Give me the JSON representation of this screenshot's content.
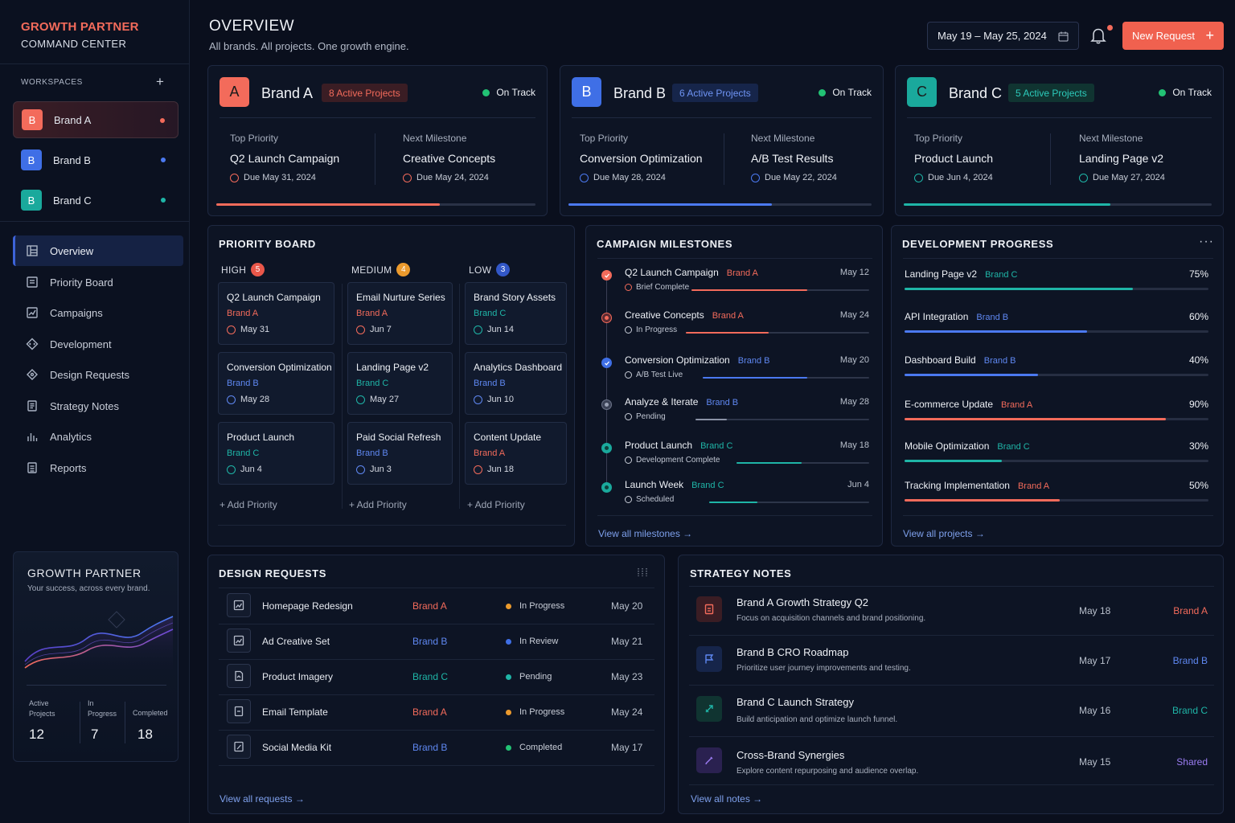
{
  "colors": {
    "brandA": "#f36b5b",
    "brandB": "#4b79f0",
    "brandC": "#1fb5a7",
    "accent": "#f0614f",
    "onTrack": "#22c274",
    "shared": "#9b7cf2"
  },
  "sidebar": {
    "logo_line1": "GROWTH PARTNER",
    "logo_line2": "COMMAND CENTER",
    "workspaces_label": "WORKSPACES",
    "workspaces": [
      {
        "letter": "B",
        "name": "Brand A"
      },
      {
        "letter": "B",
        "name": "Brand B"
      },
      {
        "letter": "B",
        "name": "Brand C"
      }
    ],
    "nav": [
      {
        "label": "Overview",
        "icon": "overview-icon"
      },
      {
        "label": "Priority Board",
        "icon": "board-icon"
      },
      {
        "label": "Campaigns",
        "icon": "campaigns-icon"
      },
      {
        "label": "Development",
        "icon": "development-icon"
      },
      {
        "label": "Design Requests",
        "icon": "design-icon"
      },
      {
        "label": "Strategy Notes",
        "icon": "notes-icon"
      },
      {
        "label": "Analytics",
        "icon": "analytics-icon"
      },
      {
        "label": "Reports",
        "icon": "reports-icon"
      }
    ],
    "promo": {
      "title": "GROWTH PARTNER",
      "subtitle": "Your success, across every brand.",
      "stats": [
        {
          "label_1": "Active",
          "label_2": "Projects",
          "value": "12"
        },
        {
          "label_1": "In",
          "label_2": "Progress",
          "value": "7"
        },
        {
          "label_1": "Completed",
          "label_2": "",
          "value": "18"
        }
      ]
    }
  },
  "header": {
    "title": "OVERVIEW",
    "subtitle": "All brands. All projects. One growth engine.",
    "date_range": "May 19 – May 25, 2024",
    "new_request": "New Request"
  },
  "brands": [
    {
      "letter": "A",
      "name": "Brand A",
      "projects": "8 Active Projects",
      "status": "On Track",
      "top_label": "Top Priority",
      "top_value": "Q2 Launch Campaign",
      "top_due": "Due May 31, 2024",
      "next_label": "Next Milestone",
      "next_value": "Creative Concepts",
      "next_due": "Due May 24, 2024",
      "progress": 0.7
    },
    {
      "letter": "B",
      "name": "Brand B",
      "projects": "6 Active Projects",
      "status": "On Track",
      "top_label": "Top Priority",
      "top_value": "Conversion Optimization",
      "top_due": "Due May 28, 2024",
      "next_label": "Next Milestone",
      "next_value": "A/B Test Results",
      "next_due": "Due May 22, 2024",
      "progress": 0.67
    },
    {
      "letter": "C",
      "name": "Brand C",
      "projects": "5 Active Projects",
      "status": "On Track",
      "top_label": "Top Priority",
      "top_value": "Product Launch",
      "top_due": "Due Jun 4, 2024",
      "next_label": "Next Milestone",
      "next_value": "Landing Page v2",
      "next_due": "Due May 27, 2024",
      "progress": 0.67
    }
  ],
  "priority_board": {
    "title": "PRIORITY BOARD",
    "columns": [
      {
        "label": "HIGH",
        "count": "5",
        "cards": [
          {
            "title": "Q2 Launch Campaign",
            "brand": "Brand A",
            "date": "May 31"
          },
          {
            "title": "Conversion Optimization",
            "brand": "Brand B",
            "date": "May 28"
          },
          {
            "title": "Product Launch",
            "brand": "Brand C",
            "date": "Jun 4"
          }
        ]
      },
      {
        "label": "MEDIUM",
        "count": "4",
        "cards": [
          {
            "title": "Email Nurture Series",
            "brand": "Brand A",
            "date": "Jun 7"
          },
          {
            "title": "Landing Page v2",
            "brand": "Brand C",
            "date": "May 27"
          },
          {
            "title": "Paid Social Refresh",
            "brand": "Brand B",
            "date": "Jun 3"
          }
        ]
      },
      {
        "label": "LOW",
        "count": "3",
        "cards": [
          {
            "title": "Brand Story Assets",
            "brand": "Brand C",
            "date": "Jun 14"
          },
          {
            "title": "Analytics Dashboard",
            "brand": "Brand B",
            "date": "Jun 10"
          },
          {
            "title": "Content Update",
            "brand": "Brand A",
            "date": "Jun 18"
          }
        ]
      }
    ],
    "add_label": "+ Add Priority"
  },
  "milestones": {
    "title": "CAMPAIGN MILESTONES",
    "items": [
      {
        "title": "Q2 Launch Campaign",
        "brand": "Brand A",
        "status": "Brief Complete",
        "date": "May 12",
        "progress": 0.65
      },
      {
        "title": "Creative Concepts",
        "brand": "Brand A",
        "status": "In Progress",
        "date": "May 24",
        "progress": 0.45
      },
      {
        "title": "Conversion Optimization",
        "brand": "Brand B",
        "status": "A/B Test Live",
        "date": "May 20",
        "progress": 0.63
      },
      {
        "title": "Analyze & Iterate",
        "brand": "Brand B",
        "status": "Pending",
        "date": "May 28",
        "progress": 0.18
      },
      {
        "title": "Product Launch",
        "brand": "Brand C",
        "status": "Development Complete",
        "date": "May 18",
        "progress": 0.49
      },
      {
        "title": "Launch Week",
        "brand": "Brand C",
        "status": "Scheduled",
        "date": "Jun 4",
        "progress": 0.3
      }
    ],
    "view_all": "View all milestones →"
  },
  "development": {
    "title": "DEVELOPMENT PROGRESS",
    "items": [
      {
        "title": "Landing Page v2",
        "brand": "Brand C",
        "percent": "75%",
        "progress": 0.75
      },
      {
        "title": "API Integration",
        "brand": "Brand B",
        "percent": "60%",
        "progress": 0.6
      },
      {
        "title": "Dashboard Build",
        "brand": "Brand B",
        "percent": "40%",
        "progress": 0.44
      },
      {
        "title": "E-commerce Update",
        "brand": "Brand A",
        "percent": "90%",
        "progress": 0.86
      },
      {
        "title": "Mobile Optimization",
        "brand": "Brand C",
        "percent": "30%",
        "progress": 0.32
      },
      {
        "title": "Tracking Implementation",
        "brand": "Brand A",
        "percent": "50%",
        "progress": 0.51
      }
    ],
    "view_all": "View all projects →"
  },
  "design_requests": {
    "title": "DESIGN REQUESTS",
    "rows": [
      {
        "name": "Homepage Redesign",
        "brand": "Brand A",
        "status": "In Progress",
        "date": "May 20"
      },
      {
        "name": "Ad Creative Set",
        "brand": "Brand B",
        "status": "In Review",
        "date": "May 21"
      },
      {
        "name": "Product Imagery",
        "brand": "Brand C",
        "status": "Pending",
        "date": "May 23"
      },
      {
        "name": "Email Template",
        "brand": "Brand A",
        "status": "In Progress",
        "date": "May 24"
      },
      {
        "name": "Social Media Kit",
        "brand": "Brand B",
        "status": "Completed",
        "date": "May 17"
      }
    ],
    "view_all": "View all requests →"
  },
  "strategy_notes": {
    "title": "STRATEGY NOTES",
    "rows": [
      {
        "title": "Brand A Growth Strategy Q2",
        "subtitle": "Focus on acquisition channels and brand positioning.",
        "date": "May 18",
        "brand": "Brand A"
      },
      {
        "title": "Brand B CRO Roadmap",
        "subtitle": "Prioritize user journey improvements and testing.",
        "date": "May 17",
        "brand": "Brand B"
      },
      {
        "title": "Brand C Launch Strategy",
        "subtitle": "Build anticipation and optimize launch funnel.",
        "date": "May 16",
        "brand": "Brand C"
      },
      {
        "title": "Cross-Brand Synergies",
        "subtitle": "Explore content repurposing and audience overlap.",
        "date": "May 15",
        "brand": "Shared"
      }
    ],
    "view_all": "View all notes →"
  }
}
